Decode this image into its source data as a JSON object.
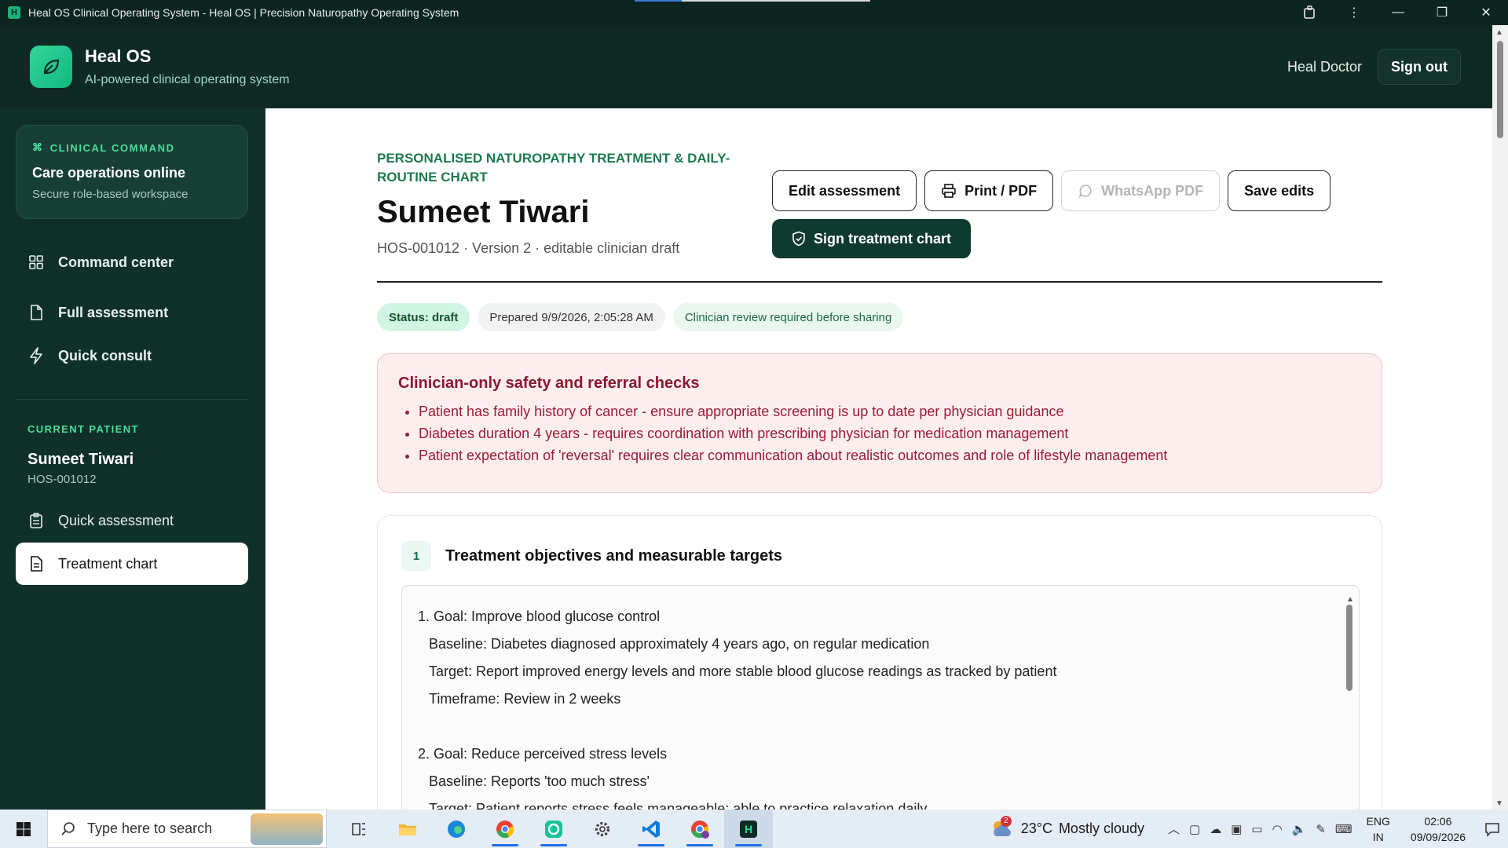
{
  "window": {
    "title": "Heal OS Clinical Operating System - Heal OS | Precision Naturopathy Operating System",
    "page_load_progress": 0.2
  },
  "header": {
    "brand_name": "Heal OS",
    "tagline": "AI-powered clinical operating system",
    "user_name": "Heal Doctor",
    "signout_label": "Sign out"
  },
  "sidebar": {
    "command_card": {
      "eyebrow": "CLINICAL COMMAND",
      "title": "Care operations online",
      "subtitle": "Secure role-based workspace"
    },
    "nav": [
      {
        "label": "Command center",
        "icon": "grid-icon"
      },
      {
        "label": "Full assessment",
        "icon": "document-edit-icon"
      },
      {
        "label": "Quick consult",
        "icon": "lightning-icon"
      }
    ],
    "current_patient": {
      "label": "CURRENT PATIENT",
      "name": "Sumeet Tiwari",
      "id": "HOS-001012"
    },
    "patient_nav": [
      {
        "label": "Quick assessment",
        "icon": "clipboard-icon",
        "active": false
      },
      {
        "label": "Treatment chart",
        "icon": "file-icon",
        "active": true
      }
    ]
  },
  "main": {
    "eyebrow": "PERSONALISED NATUROPATHY TREATMENT & DAILY-ROUTINE CHART",
    "patient_name": "Sumeet Tiwari",
    "meta": "HOS-001012 · Version 2 · editable clinician draft",
    "buttons": {
      "edit": "Edit assessment",
      "print": "Print / PDF",
      "whatsapp": "WhatsApp PDF",
      "save": "Save edits",
      "sign": "Sign treatment chart"
    },
    "chips": {
      "status": "Status: draft",
      "prepared": "Prepared 9/9/2026, 2:05:28 AM",
      "review": "Clinician review required before sharing"
    },
    "alert": {
      "title": "Clinician-only safety and referral checks",
      "items": [
        "Patient has family history of cancer - ensure appropriate screening is up to date per physician guidance",
        "Diabetes duration 4 years - requires coordination with prescribing physician for medication management",
        "Patient expectation of 'reversal' requires clear communication about realistic outcomes and role of lifestyle management"
      ]
    },
    "section1": {
      "number": "1",
      "title": "Treatment objectives and measurable targets",
      "lines": [
        "1. Goal: Improve blood glucose control",
        "Baseline: Diabetes diagnosed approximately 4 years ago, on regular medication",
        "Target: Report improved energy levels and more stable blood glucose readings as tracked by patient",
        "Timeframe: Review in 2 weeks",
        "2. Goal: Reduce perceived stress levels",
        "Baseline: Reports 'too much stress'",
        "Target: Patient reports stress feels manageable; able to practice relaxation daily"
      ]
    }
  },
  "taskbar": {
    "search_placeholder": "Type here to search",
    "weather_temp": "23°C",
    "weather_text": "Mostly cloudy",
    "weather_badge": "2",
    "lang_top": "ENG",
    "lang_bottom": "IN",
    "time": "02:06",
    "date": "09/09/2026"
  }
}
